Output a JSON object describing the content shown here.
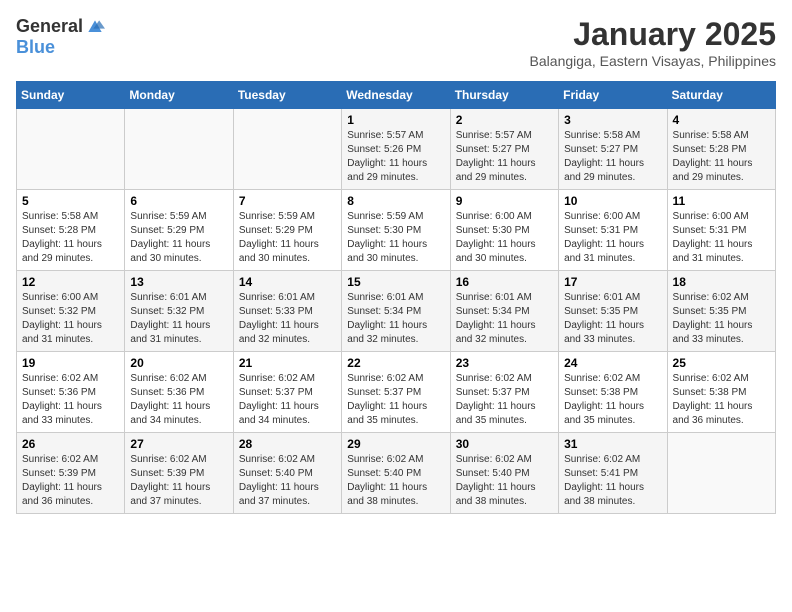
{
  "logo": {
    "general": "General",
    "blue": "Blue"
  },
  "title": "January 2025",
  "location": "Balangiga, Eastern Visayas, Philippines",
  "weekdays": [
    "Sunday",
    "Monday",
    "Tuesday",
    "Wednesday",
    "Thursday",
    "Friday",
    "Saturday"
  ],
  "weeks": [
    [
      {
        "day": "",
        "info": ""
      },
      {
        "day": "",
        "info": ""
      },
      {
        "day": "",
        "info": ""
      },
      {
        "day": "1",
        "info": "Sunrise: 5:57 AM\nSunset: 5:26 PM\nDaylight: 11 hours and 29 minutes."
      },
      {
        "day": "2",
        "info": "Sunrise: 5:57 AM\nSunset: 5:27 PM\nDaylight: 11 hours and 29 minutes."
      },
      {
        "day": "3",
        "info": "Sunrise: 5:58 AM\nSunset: 5:27 PM\nDaylight: 11 hours and 29 minutes."
      },
      {
        "day": "4",
        "info": "Sunrise: 5:58 AM\nSunset: 5:28 PM\nDaylight: 11 hours and 29 minutes."
      }
    ],
    [
      {
        "day": "5",
        "info": "Sunrise: 5:58 AM\nSunset: 5:28 PM\nDaylight: 11 hours and 29 minutes."
      },
      {
        "day": "6",
        "info": "Sunrise: 5:59 AM\nSunset: 5:29 PM\nDaylight: 11 hours and 30 minutes."
      },
      {
        "day": "7",
        "info": "Sunrise: 5:59 AM\nSunset: 5:29 PM\nDaylight: 11 hours and 30 minutes."
      },
      {
        "day": "8",
        "info": "Sunrise: 5:59 AM\nSunset: 5:30 PM\nDaylight: 11 hours and 30 minutes."
      },
      {
        "day": "9",
        "info": "Sunrise: 6:00 AM\nSunset: 5:30 PM\nDaylight: 11 hours and 30 minutes."
      },
      {
        "day": "10",
        "info": "Sunrise: 6:00 AM\nSunset: 5:31 PM\nDaylight: 11 hours and 31 minutes."
      },
      {
        "day": "11",
        "info": "Sunrise: 6:00 AM\nSunset: 5:31 PM\nDaylight: 11 hours and 31 minutes."
      }
    ],
    [
      {
        "day": "12",
        "info": "Sunrise: 6:00 AM\nSunset: 5:32 PM\nDaylight: 11 hours and 31 minutes."
      },
      {
        "day": "13",
        "info": "Sunrise: 6:01 AM\nSunset: 5:32 PM\nDaylight: 11 hours and 31 minutes."
      },
      {
        "day": "14",
        "info": "Sunrise: 6:01 AM\nSunset: 5:33 PM\nDaylight: 11 hours and 32 minutes."
      },
      {
        "day": "15",
        "info": "Sunrise: 6:01 AM\nSunset: 5:34 PM\nDaylight: 11 hours and 32 minutes."
      },
      {
        "day": "16",
        "info": "Sunrise: 6:01 AM\nSunset: 5:34 PM\nDaylight: 11 hours and 32 minutes."
      },
      {
        "day": "17",
        "info": "Sunrise: 6:01 AM\nSunset: 5:35 PM\nDaylight: 11 hours and 33 minutes."
      },
      {
        "day": "18",
        "info": "Sunrise: 6:02 AM\nSunset: 5:35 PM\nDaylight: 11 hours and 33 minutes."
      }
    ],
    [
      {
        "day": "19",
        "info": "Sunrise: 6:02 AM\nSunset: 5:36 PM\nDaylight: 11 hours and 33 minutes."
      },
      {
        "day": "20",
        "info": "Sunrise: 6:02 AM\nSunset: 5:36 PM\nDaylight: 11 hours and 34 minutes."
      },
      {
        "day": "21",
        "info": "Sunrise: 6:02 AM\nSunset: 5:37 PM\nDaylight: 11 hours and 34 minutes."
      },
      {
        "day": "22",
        "info": "Sunrise: 6:02 AM\nSunset: 5:37 PM\nDaylight: 11 hours and 35 minutes."
      },
      {
        "day": "23",
        "info": "Sunrise: 6:02 AM\nSunset: 5:37 PM\nDaylight: 11 hours and 35 minutes."
      },
      {
        "day": "24",
        "info": "Sunrise: 6:02 AM\nSunset: 5:38 PM\nDaylight: 11 hours and 35 minutes."
      },
      {
        "day": "25",
        "info": "Sunrise: 6:02 AM\nSunset: 5:38 PM\nDaylight: 11 hours and 36 minutes."
      }
    ],
    [
      {
        "day": "26",
        "info": "Sunrise: 6:02 AM\nSunset: 5:39 PM\nDaylight: 11 hours and 36 minutes."
      },
      {
        "day": "27",
        "info": "Sunrise: 6:02 AM\nSunset: 5:39 PM\nDaylight: 11 hours and 37 minutes."
      },
      {
        "day": "28",
        "info": "Sunrise: 6:02 AM\nSunset: 5:40 PM\nDaylight: 11 hours and 37 minutes."
      },
      {
        "day": "29",
        "info": "Sunrise: 6:02 AM\nSunset: 5:40 PM\nDaylight: 11 hours and 38 minutes."
      },
      {
        "day": "30",
        "info": "Sunrise: 6:02 AM\nSunset: 5:40 PM\nDaylight: 11 hours and 38 minutes."
      },
      {
        "day": "31",
        "info": "Sunrise: 6:02 AM\nSunset: 5:41 PM\nDaylight: 11 hours and 38 minutes."
      },
      {
        "day": "",
        "info": ""
      }
    ]
  ]
}
